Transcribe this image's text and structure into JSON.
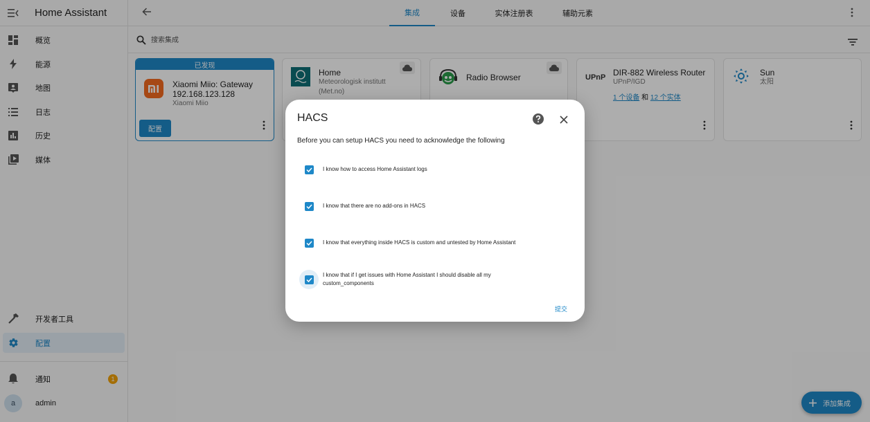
{
  "sidebar": {
    "title": "Home Assistant",
    "items": [
      {
        "label": "概览"
      },
      {
        "label": "能源"
      },
      {
        "label": "地图"
      },
      {
        "label": "日志"
      },
      {
        "label": "历史"
      },
      {
        "label": "媒体"
      }
    ],
    "dev_tools": "开发者工具",
    "config": "配置",
    "notifications": "通知",
    "notification_count": "1",
    "user_initial": "a",
    "user_name": "admin"
  },
  "topbar": {
    "tabs": [
      "集成",
      "设备",
      "实体注册表",
      "辅助元素"
    ],
    "active_tab": 0
  },
  "search": {
    "placeholder": "搜索集成"
  },
  "cards": {
    "discovered": {
      "header": "已发现",
      "title_line1": "Xiaomi Miio: Gateway",
      "title_line2": "192.168.123.128",
      "subtitle": "Xiaomi Miio",
      "button": "配置"
    },
    "met": {
      "title": "Home",
      "subtitle_line1": "Meteorologisk institutt",
      "subtitle_line2": "(Met.no)"
    },
    "radio": {
      "title": "Radio Browser"
    },
    "upnp": {
      "title": "DIR-882 Wireless Router",
      "subtitle": "UPnP/IGD",
      "logo": "UPnP",
      "devices_link": "1 个设备",
      "and": "和",
      "entities_link": "12 个实体"
    },
    "sun": {
      "title": "Sun",
      "subtitle": "太阳"
    }
  },
  "dialog": {
    "title": "HACS",
    "description": "Before you can setup HACS you need to acknowledge the following",
    "checkboxes": [
      {
        "label": "I know how to access Home Assistant logs",
        "checked": true
      },
      {
        "label": "I know that there are no add-ons in HACS",
        "checked": true
      },
      {
        "label": "I know that everything inside HACS is custom and untested by Home Assistant",
        "checked": true
      },
      {
        "label_line1": "I know that if I get issues with Home Assistant I should disable all my",
        "label_line2": "custom_components",
        "checked": true
      }
    ],
    "submit": "提交"
  },
  "fab": {
    "label": "添加集成"
  },
  "colors": {
    "accent": "#1e88c8",
    "badge": "#f2a20a",
    "xiaomi": "#f56a1f",
    "met": "#0e6f76"
  }
}
